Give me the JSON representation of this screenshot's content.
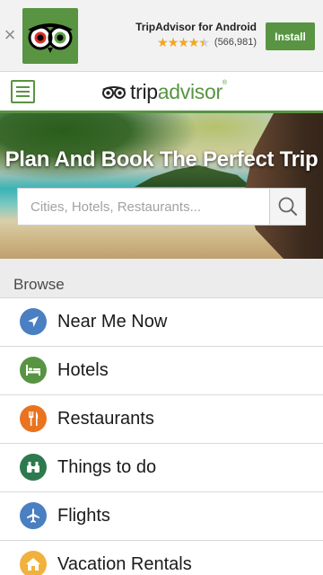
{
  "banner": {
    "close_glyph": "×",
    "app_name": "TripAdvisor for Android",
    "rating": 4.5,
    "rating_max": 5,
    "rating_count": "(566,981)",
    "install_label": "Install",
    "accent_color": "#589442",
    "star_color": "#f2a81d"
  },
  "header": {
    "menu_icon": "hamburger-menu-icon",
    "logo_trip": "trip",
    "logo_advisor": "advisor",
    "logo_tm": "®",
    "brand_color": "#589442"
  },
  "hero": {
    "title": "Plan And Book The Perfect Trip",
    "search_placeholder": "Cities, Hotels, Restaurants...",
    "search_value": "",
    "search_icon": "search-icon"
  },
  "browse": {
    "heading": "Browse",
    "items": [
      {
        "label": "Near Me Now",
        "icon": "location-arrow-icon",
        "color": "#4a7fc1"
      },
      {
        "label": "Hotels",
        "icon": "bed-icon",
        "color": "#589442"
      },
      {
        "label": "Restaurants",
        "icon": "fork-knife-icon",
        "color": "#e9731f"
      },
      {
        "label": "Things to do",
        "icon": "binoculars-icon",
        "color": "#2e7a4f"
      },
      {
        "label": "Flights",
        "icon": "airplane-icon",
        "color": "#4a7fc1"
      },
      {
        "label": "Vacation Rentals",
        "icon": "house-icon",
        "color": "#f2b13c"
      }
    ]
  }
}
